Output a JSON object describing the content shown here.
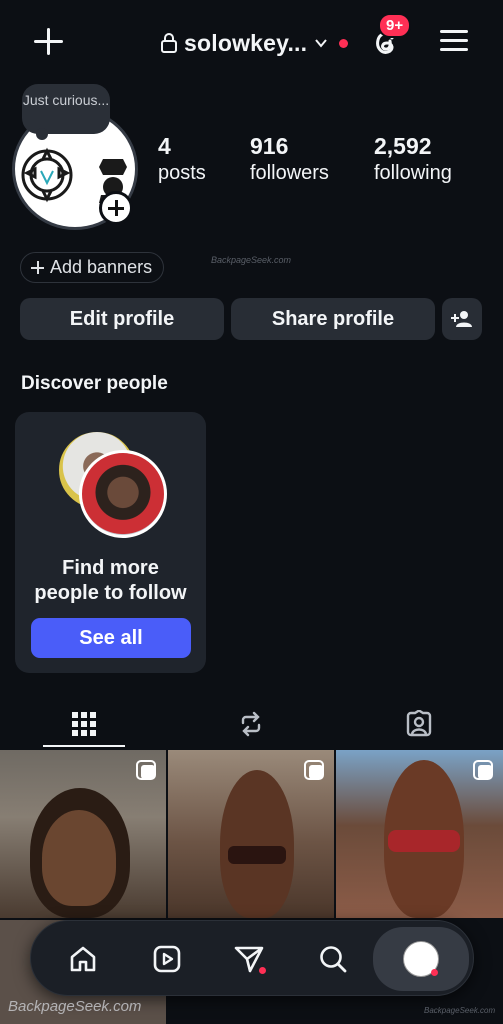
{
  "header": {
    "username": "solowkey...",
    "notification_badge": "9+"
  },
  "profile": {
    "note": "Just curious...",
    "stats": [
      {
        "value": "4",
        "label": "posts"
      },
      {
        "value": "916",
        "label": "followers"
      },
      {
        "value": "2,592",
        "label": "following"
      }
    ],
    "add_banners_label": "Add banners",
    "watermark": "BackpageSeek.com",
    "edit_profile_label": "Edit profile",
    "share_profile_label": "Share profile"
  },
  "discover": {
    "title": "Discover people",
    "card_text_line1": "Find more",
    "card_text_line2": "people to follow",
    "see_all_label": "See all"
  },
  "tabs": [
    "grid-icon",
    "reposts-icon",
    "tagged-icon"
  ],
  "footer": {
    "watermark_left": "BackpageSeek.com",
    "watermark_right": "BackpageSeek.com"
  },
  "colors": {
    "background": "#0c0f14",
    "button": "#282d35",
    "accent": "#4a5df9",
    "notification": "#ff2f55"
  }
}
